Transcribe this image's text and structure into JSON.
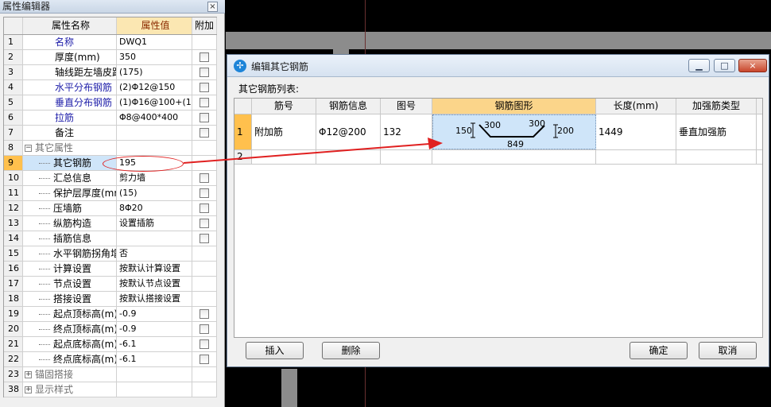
{
  "prop_editor": {
    "title": "属性编辑器",
    "close": "×",
    "headers": {
      "num": "",
      "name": "属性名称",
      "value": "属性值",
      "extra": "附加"
    },
    "rows": [
      {
        "num": "1",
        "name": "名称",
        "value": "DWQ1",
        "checkbox": false,
        "style": "blue"
      },
      {
        "num": "2",
        "name": "厚度(mm)",
        "value": "350",
        "checkbox": true,
        "style": "plain"
      },
      {
        "num": "3",
        "name": "轴线距左墙皮距离",
        "value": "(175)",
        "checkbox": true,
        "style": "plain"
      },
      {
        "num": "4",
        "name": "水平分布钢筋",
        "value": "(2)Φ12@150",
        "checkbox": true,
        "style": "blue"
      },
      {
        "num": "5",
        "name": "垂直分布钢筋",
        "value": "(1)Φ16@100+(1",
        "checkbox": true,
        "style": "blue"
      },
      {
        "num": "6",
        "name": "拉筋",
        "value": "Φ8@400*400",
        "checkbox": true,
        "style": "blue"
      },
      {
        "num": "7",
        "name": "备注",
        "value": "",
        "checkbox": true,
        "style": "plain"
      },
      {
        "num": "8",
        "name": "其它属性",
        "value": "",
        "checkbox": false,
        "style": "group",
        "expander": "−"
      },
      {
        "num": "9",
        "name": "其它钢筋",
        "value": "195",
        "checkbox": false,
        "style": "child",
        "selected": true
      },
      {
        "num": "10",
        "name": "汇总信息",
        "value": "剪力墙",
        "checkbox": true,
        "style": "child"
      },
      {
        "num": "11",
        "name": "保护层厚度(mm)",
        "value": "(15)",
        "checkbox": true,
        "style": "child"
      },
      {
        "num": "12",
        "name": "压墙筋",
        "value": "8Φ20",
        "checkbox": true,
        "style": "child"
      },
      {
        "num": "13",
        "name": "纵筋构造",
        "value": "设置插筋",
        "checkbox": true,
        "style": "child"
      },
      {
        "num": "14",
        "name": "插筋信息",
        "value": "",
        "checkbox": true,
        "style": "child"
      },
      {
        "num": "15",
        "name": "水平钢筋拐角增",
        "value": "否",
        "checkbox": false,
        "style": "child"
      },
      {
        "num": "16",
        "name": "计算设置",
        "value": "按默认计算设置",
        "checkbox": false,
        "style": "child"
      },
      {
        "num": "17",
        "name": "节点设置",
        "value": "按默认节点设置",
        "checkbox": false,
        "style": "child"
      },
      {
        "num": "18",
        "name": "搭接设置",
        "value": "按默认搭接设置",
        "checkbox": false,
        "style": "child"
      },
      {
        "num": "19",
        "name": "起点顶标高(m)",
        "value": "-0.9",
        "checkbox": true,
        "style": "child"
      },
      {
        "num": "20",
        "name": "终点顶标高(m)",
        "value": "-0.9",
        "checkbox": true,
        "style": "child"
      },
      {
        "num": "21",
        "name": "起点底标高(m)",
        "value": "-6.1",
        "checkbox": true,
        "style": "child"
      },
      {
        "num": "22",
        "name": "终点底标高(m)",
        "value": "-6.1",
        "checkbox": true,
        "style": "child"
      },
      {
        "num": "23",
        "name": "锚固搭接",
        "value": "",
        "checkbox": false,
        "style": "group",
        "expander": "+"
      },
      {
        "num": "38",
        "name": "显示样式",
        "value": "",
        "checkbox": false,
        "style": "group",
        "expander": "+"
      }
    ]
  },
  "dialog": {
    "title": "编辑其它钢筋",
    "app_icon": "app-logo-icon",
    "minimize": "▁",
    "maximize": "□",
    "close": "×",
    "list_label": "其它钢筋列表:",
    "columns": [
      "",
      "筋号",
      "钢筋信息",
      "图号",
      "钢筋图形",
      "长度(mm)",
      "加强筋类型"
    ],
    "rows": [
      {
        "num": "1",
        "no": "附加筋",
        "info": "Φ12@200",
        "fig": "132",
        "shape": {
          "left_hook": "150",
          "top_left": "300",
          "top_right": "300",
          "right_hook": "200",
          "bottom": "849"
        },
        "length": "1449",
        "type": "垂直加强筋"
      },
      {
        "num": "2",
        "no": "",
        "info": "",
        "fig": "",
        "length": "",
        "type": ""
      }
    ],
    "buttons": {
      "insert": "插入",
      "delete": "删除",
      "ok": "确定",
      "cancel": "取消"
    }
  },
  "colors": {
    "annotation": "#e02020",
    "selected_row": "#ffc04d",
    "header_highlight": "#fbd58a"
  }
}
